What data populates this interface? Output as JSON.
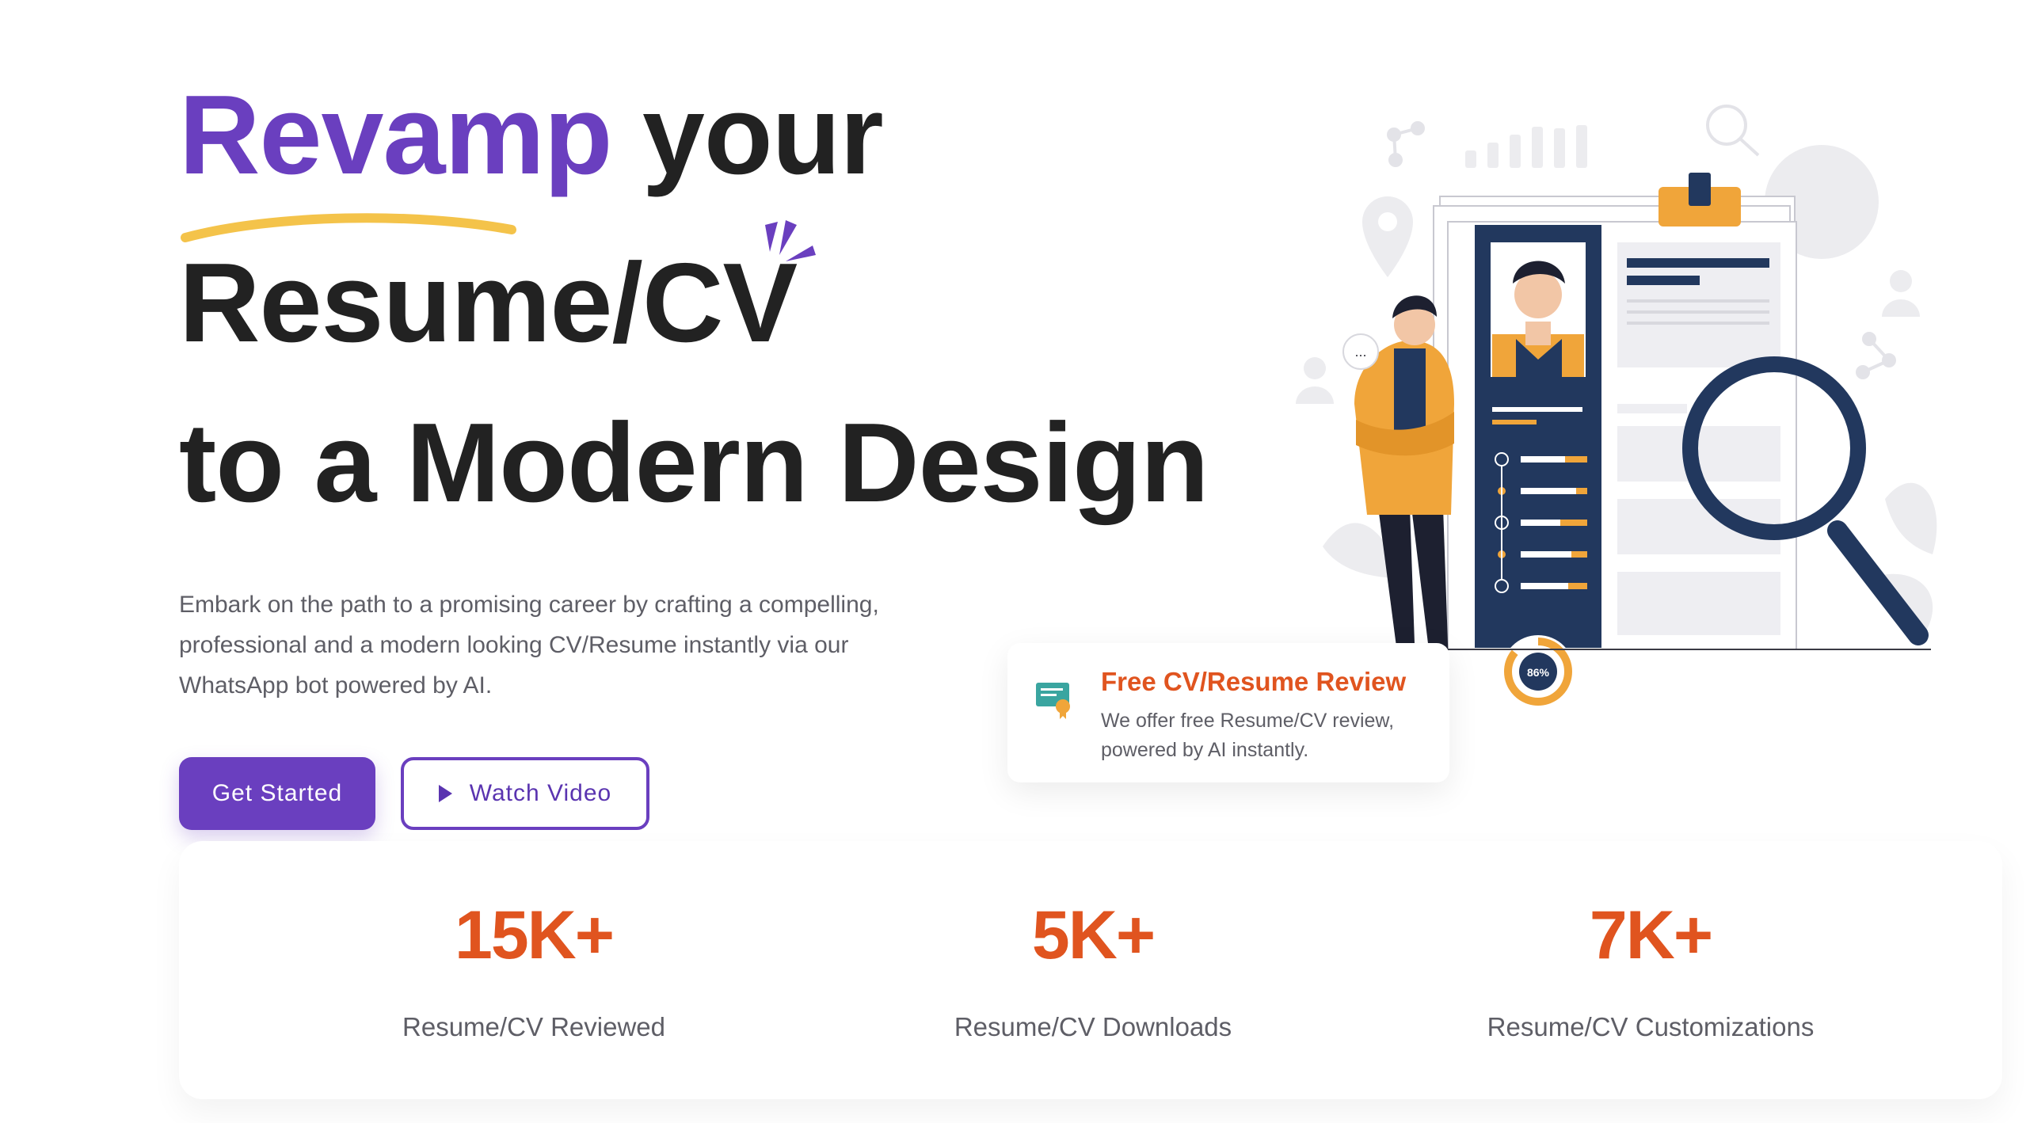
{
  "hero": {
    "headline": {
      "accent_word": "Revamp",
      "line1_rest": "your",
      "line2": "Resume/CV",
      "line3": "to a Modern Design"
    },
    "description": "Embark on the path to a promising career by crafting a compelling, professional and a modern looking CV/Resume instantly via our WhatsApp bot powered by AI.",
    "buttons": {
      "get_started_label": "Get Started",
      "watch_video_label": "Watch Video"
    }
  },
  "illustration": {
    "score_text": "86%",
    "speech_bubble_text": "..."
  },
  "review_card": {
    "title": "Free CV/Resume Review",
    "text": "We offer free Resume/CV review, powered by AI instantly."
  },
  "stats": [
    {
      "value": "15K+",
      "label": "Resume/CV Reviewed"
    },
    {
      "value": "5K+",
      "label": "Resume/CV Downloads"
    },
    {
      "value": "7K+",
      "label": "Resume/CV Customizations"
    }
  ],
  "colors": {
    "accent_purple": "#6a3fbf",
    "accent_orange": "#e0541f",
    "swoosh_yellow": "#f4c34a",
    "text_dark": "#222222",
    "text_muted": "#5e5e66",
    "navy": "#22385e"
  }
}
